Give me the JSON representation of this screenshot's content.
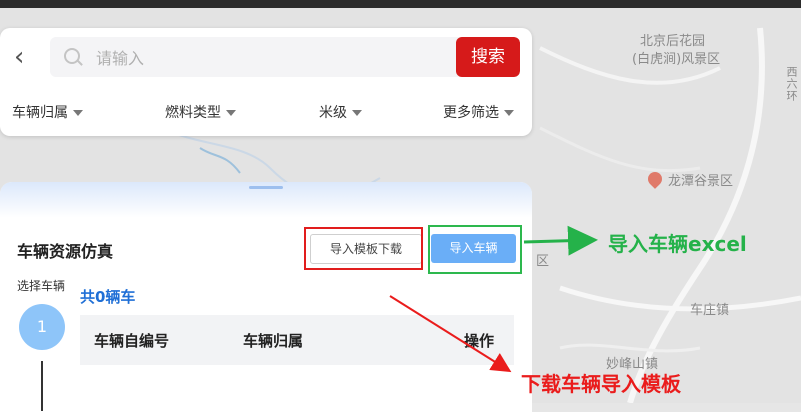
{
  "map": {
    "labels": [
      "北京后花园",
      "(白虎涧)风景区",
      "龙潭谷景区",
      "车庄镇",
      "妙峰山镇",
      "区"
    ],
    "vertical_label": "西六环"
  },
  "search": {
    "placeholder": "请输入",
    "button_label": "搜索"
  },
  "filters": [
    {
      "label": "车辆归属"
    },
    {
      "label": "燃料类型"
    },
    {
      "label": "米级"
    },
    {
      "label": "更多筛选"
    }
  ],
  "panel": {
    "title": "车辆资源仿真",
    "template_button": "导入模板下载",
    "import_button": "导入车辆",
    "step_label": "选择车辆",
    "step_number": "1",
    "count_text": "共0辆车",
    "columns": [
      "车辆自编号",
      "车辆归属",
      "操作"
    ]
  },
  "annotations": {
    "green_note": "导入车辆excel",
    "red_note": "下载车辆导入模板"
  },
  "colors": {
    "search_button": "#d61a1a",
    "import_button": "#6aaef7",
    "step_circle": "#8ec5f9",
    "count_text": "#1f6fd6",
    "annotation_green": "#25b24a",
    "annotation_red": "#ea1c1c"
  }
}
